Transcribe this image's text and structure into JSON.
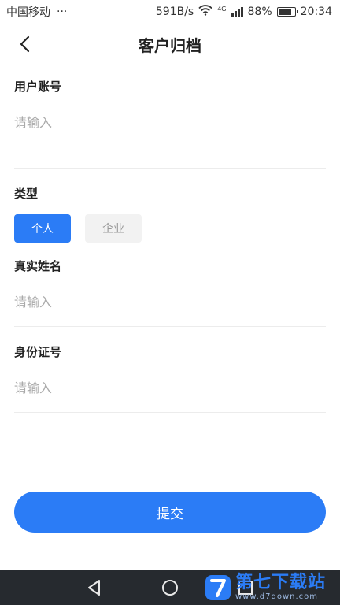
{
  "status_bar": {
    "carrier": "中国移动",
    "more": "···",
    "speed": "591B/s",
    "net_type": "4G",
    "battery": "88%",
    "battery_level": 0.88,
    "time": "20:34"
  },
  "header": {
    "title": "客户归档"
  },
  "form": {
    "account_label": "用户账号",
    "account_placeholder": "请输入",
    "type_label": "类型",
    "type_options": [
      "个人",
      "企业"
    ],
    "type_selected": "个人",
    "name_label": "真实姓名",
    "name_placeholder": "请输入",
    "id_label": "身份证号",
    "id_placeholder": "请输入"
  },
  "submit_label": "提交",
  "watermark": {
    "title": "第七下载站",
    "url": "www.d7down.com"
  },
  "colors": {
    "accent": "#2b7cf6",
    "nav_bg": "#262a2f"
  }
}
